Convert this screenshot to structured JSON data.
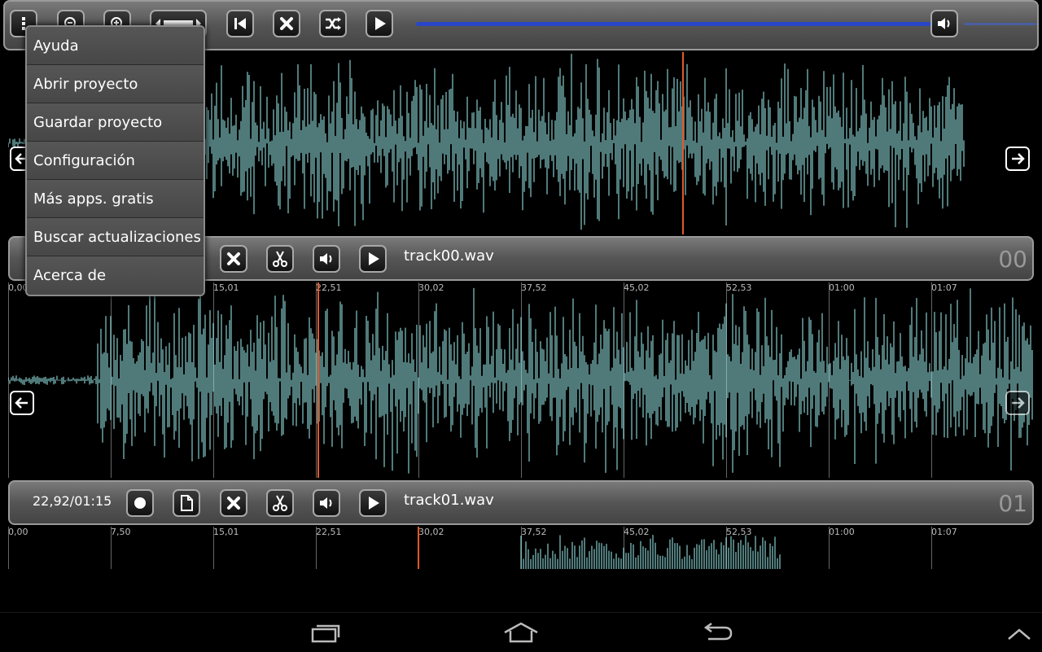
{
  "menu": {
    "items": [
      {
        "label": "Ayuda"
      },
      {
        "label": "Abrir proyecto"
      },
      {
        "label": "Guardar proyecto"
      },
      {
        "label": "Configuración"
      },
      {
        "label": "Más apps. gratis"
      },
      {
        "label": "Buscar actualizaciones"
      },
      {
        "label": "Acerca de"
      }
    ]
  },
  "tracks": [
    {
      "name": "track00.wav",
      "number": "00",
      "time": ""
    },
    {
      "name": "track01.wav",
      "number": "01",
      "time": "22,92/01:15"
    }
  ],
  "ruler": {
    "ticks": [
      "0,00",
      "7,50",
      "15,01",
      "22,51",
      "30,02",
      "37,52",
      "45,02",
      "52,53",
      "01:00",
      "01:07"
    ]
  },
  "colors": {
    "waveform": "#9ff3f5",
    "cursor": "#e05a2a",
    "volume": "#2a46c8"
  }
}
